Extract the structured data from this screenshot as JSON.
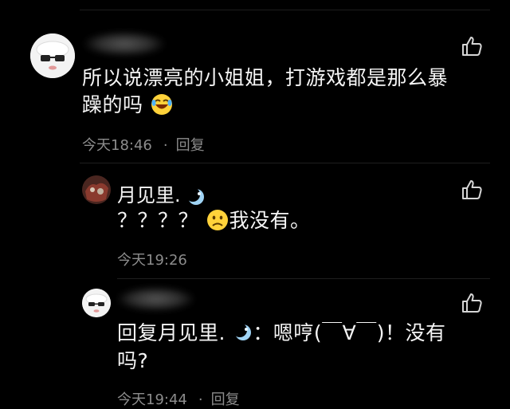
{
  "comments": [
    {
      "text_line1": "所以说漂亮的小姐姐，打游戏都是那么暴",
      "text_line2": "躁的吗",
      "time": "今天18:46",
      "reply_label": "回复",
      "separator": "·"
    },
    {
      "username": "月见里.",
      "text_prefix": "？？？？",
      "text_suffix": "我没有。",
      "time": "今天19:26"
    },
    {
      "text_line1_a": "回复月见里.",
      "text_line1_b": "：嗯哼(￣∀￣)！没有",
      "text_line2": "吗?",
      "time": "今天19:44",
      "reply_label": "回复",
      "separator": "·"
    }
  ],
  "colors": {
    "background": "#000000",
    "text": "#f5f5f5",
    "meta": "#8c8c8c"
  },
  "icons": [
    "thumbs-up-icon",
    "laughing-emoji",
    "frowning-emoji",
    "moon-badge-icon"
  ]
}
